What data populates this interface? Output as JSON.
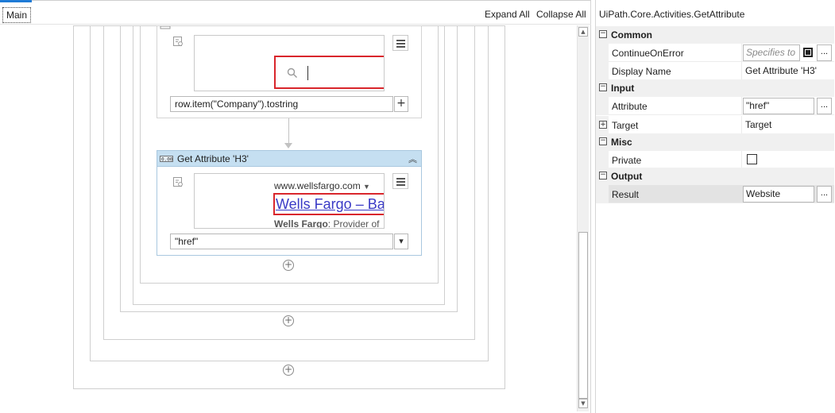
{
  "designer": {
    "breadcrumb": "Main",
    "expand_all": "Expand All",
    "collapse_all": "Collapse All",
    "card1": {
      "field_value": "row.item(\"Company\").tostring",
      "plus_label": "+"
    },
    "card2": {
      "title": "Get Attribute 'H3'",
      "collapse_glyph": "︽",
      "preview_url": "www.wellsfargo.com",
      "preview_link": "Wells Fargo – Ba",
      "preview_desc_bold": "Wells Fargo",
      "preview_desc_rest": ": Provider of",
      "attribute_value": "\"href\"",
      "dropdown_glyph": "▾"
    },
    "add_glyph": "+"
  },
  "properties": {
    "title": "UiPath.Core.Activities.GetAttribute",
    "categories": [
      {
        "label": "Common",
        "toggle": "−",
        "rows": [
          {
            "name": "ContinueOnError",
            "placeholder": "Specifies to",
            "has_checkbox": true,
            "has_dots": true
          },
          {
            "name": "Display Name",
            "value": "Get Attribute 'H3'"
          }
        ]
      },
      {
        "label": "Input",
        "toggle": "−",
        "rows": [
          {
            "name": "Attribute",
            "value": "\"href\"",
            "has_dots": true
          },
          {
            "name": "Target",
            "value": "Target",
            "expander": "+"
          }
        ]
      },
      {
        "label": "Misc",
        "toggle": "−",
        "rows": [
          {
            "name": "Private",
            "has_checkbox": true
          }
        ]
      },
      {
        "label": "Output",
        "toggle": "−",
        "rows": [
          {
            "name": "Result",
            "value": "Website",
            "has_dots": true
          }
        ]
      }
    ],
    "dots_label": "..."
  },
  "colors": {
    "accent": "#1e7bd6",
    "selector_red": "#d9262c",
    "activity_header": "#c5dff1",
    "link_blue": "#3a3ac6"
  }
}
